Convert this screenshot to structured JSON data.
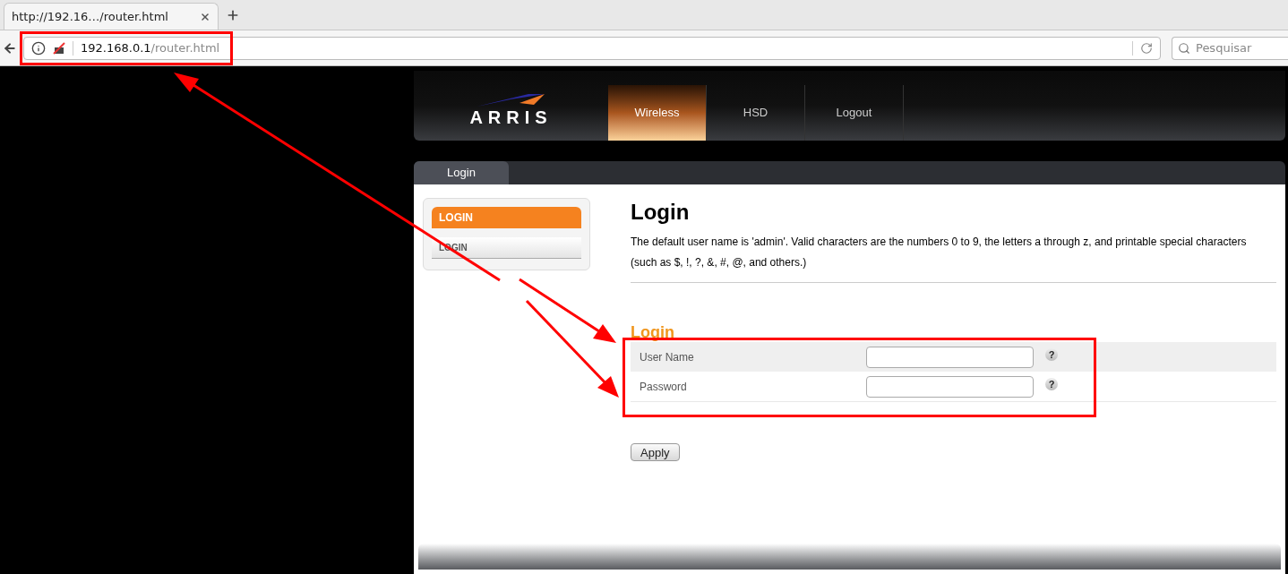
{
  "browser": {
    "tab": {
      "title": "http://192.16…/router.html"
    },
    "url": {
      "host": "192.168.0.1",
      "path": "/router.html"
    },
    "search": {
      "placeholder": "Pesquisar"
    }
  },
  "header": {
    "logo": "ARRIS",
    "nav": [
      {
        "label": "Wireless",
        "selected": true
      },
      {
        "label": "HSD",
        "selected": false
      },
      {
        "label": "Logout",
        "selected": false
      }
    ]
  },
  "subtabs": [
    {
      "label": "Login",
      "selected": true
    }
  ],
  "sidebar": {
    "title": "LOGIN",
    "items": [
      {
        "label": "LOGIN"
      }
    ]
  },
  "main": {
    "title": "Login",
    "description": "The default user name is 'admin'. Valid characters are the numbers 0 to 9, the letters a through z, and printable special characters (such as $, !, ?, &, #, @, and others.)",
    "section_title": "Login",
    "fields": [
      {
        "label": "User Name",
        "help": "?"
      },
      {
        "label": "Password",
        "help": "?"
      }
    ],
    "apply": "Apply"
  }
}
